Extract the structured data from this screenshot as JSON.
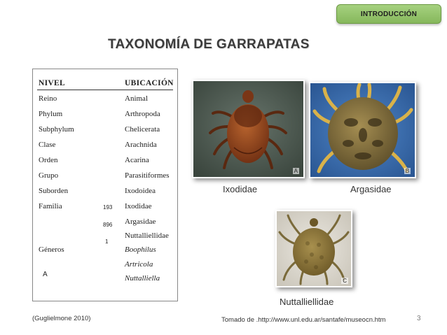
{
  "header": {
    "section_badge": "INTRODUCCIÓN",
    "title": "TAXONOMÍA DE GARRAPATAS"
  },
  "taxonomy_table": {
    "headers": {
      "level": "NIVEL",
      "location": "UBICACIÓN"
    },
    "rows": [
      {
        "level": "Reino",
        "location": "Animal",
        "count": ""
      },
      {
        "level": "Phylum",
        "location": "Arthropoda",
        "count": ""
      },
      {
        "level": "Subphylum",
        "location": "Chelicerata",
        "count": ""
      },
      {
        "level": "Clase",
        "location": "Arachnida",
        "count": ""
      },
      {
        "level": "Orden",
        "location": "Acarina",
        "count": ""
      },
      {
        "level": "Grupo",
        "location": "Parasitiformes",
        "count": ""
      },
      {
        "level": "Suborden",
        "location": "Ixodoidea",
        "count": ""
      },
      {
        "level": "Familia",
        "location": "Ixodidae",
        "count": "193"
      },
      {
        "level": "",
        "location": "Argasidae",
        "count": "896"
      },
      {
        "level": "",
        "location": "Nuttalliellidae",
        "count": "1"
      },
      {
        "level": "Géneros",
        "location": "Boophilus",
        "count": ""
      },
      {
        "level": "",
        "location": "Artricola",
        "count": ""
      },
      {
        "level": "",
        "location": "Nuttalliella",
        "count": ""
      }
    ],
    "corner_label": "A"
  },
  "photos": {
    "ixodidae": {
      "corner_label": "A",
      "caption": "Ixodidae"
    },
    "argasidae": {
      "corner_label": "B",
      "caption": "Argasidae"
    },
    "nuttalliellidae": {
      "corner_label": "C",
      "caption": "Nuttalliellidae"
    }
  },
  "footer": {
    "citation": "(Guglielmone  2010)",
    "source": "Tomado de .http://www.unl.edu.ar/santafe/museocn.htm",
    "page_number": "3"
  },
  "colors": {
    "badge": "#94c46a",
    "title": "#3b3b3b",
    "ixodidae_bg": "#4d5a50",
    "ixodidae_body": "#8a3f1c",
    "argasidae_bg": "#3c6fb0",
    "argasidae_body": "#7d6a3c",
    "nuttalliellidae_bg": "#dcd8cf",
    "nuttalliellidae_body": "#8a7438"
  }
}
